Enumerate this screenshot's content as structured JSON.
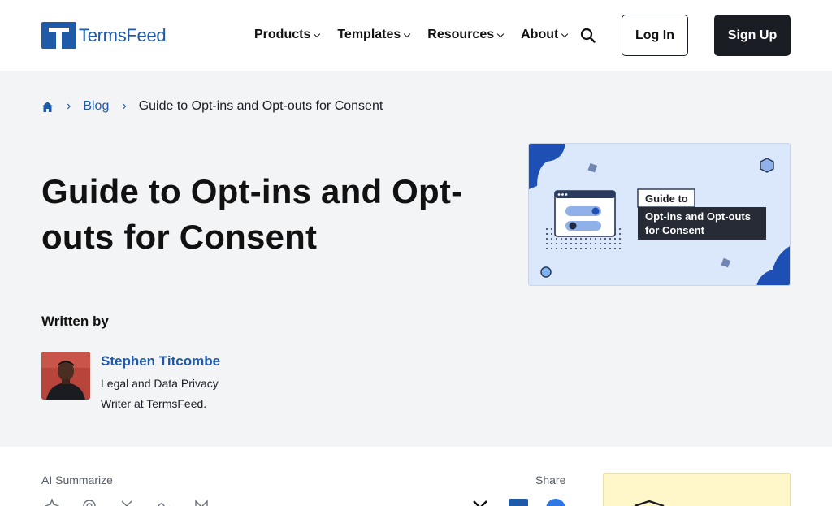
{
  "brand": {
    "name": "TermsFeed",
    "color": "#1e5aa8"
  },
  "nav": {
    "items": [
      {
        "label": "Products"
      },
      {
        "label": "Templates"
      },
      {
        "label": "Resources"
      },
      {
        "label": "About"
      }
    ],
    "search_icon": "search-icon",
    "login_label": "Log In",
    "signup_label": "Sign Up"
  },
  "breadcrumb": {
    "home_icon": "home-icon",
    "blog_label": "Blog",
    "current": "Guide to Opt-ins and Opt-outs for Consent"
  },
  "article": {
    "title": "Guide to Opt-ins and Opt-outs for Consent",
    "image": {
      "badge_top": "Guide to",
      "badge_line1": "Opt-ins and Opt-outs",
      "badge_line2": "for Consent"
    },
    "written_by_label": "Written by",
    "author": {
      "name": "Stephen Titcombe",
      "bio": "Legal and Data Privacy Writer at TermsFeed."
    }
  },
  "toolbar": {
    "ai_label": "AI Summarize",
    "share_label": "Share",
    "share_icons": [
      "x-icon",
      "linkedin-icon",
      "facebook-icon"
    ]
  }
}
